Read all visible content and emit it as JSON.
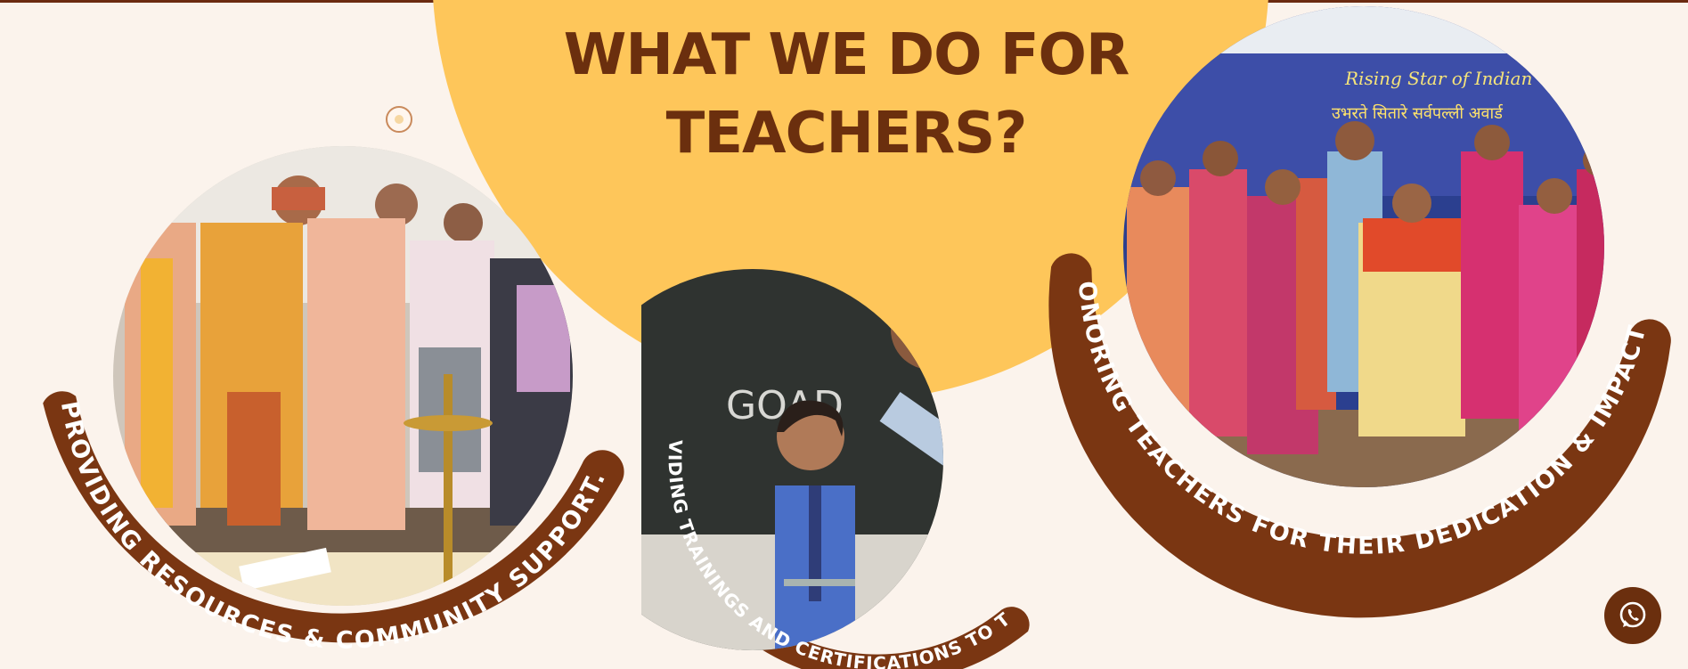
{
  "page": {
    "heading": "WHAT WE DO FOR TEACHERS?"
  },
  "cards": [
    {
      "caption": "PROVIDING RESOURCES & COMMUNITY SUPPORT.",
      "photo": "lamp-lighting-ceremony-photo"
    },
    {
      "caption": "PROVIDING TRAININGS AND CERTIFICATIONS TO THEM",
      "photo": "teacher-with-student-at-blackboard-photo"
    },
    {
      "caption": "HONORING TEACHERS FOR THEIR DEDICATION & IMPACT.",
      "photo": "award-ceremony-group-photo"
    }
  ],
  "photo_labels": {
    "blackboard_writing": "GOAD",
    "banner_title": "Rising Star of Indian",
    "banner_hindi": "उभरते सितारे सर्वपल्ली अवार्ड"
  },
  "colors": {
    "background": "#fbf3ec",
    "accent_yellow": "#fec65a",
    "brand_brown": "#6b2f0e",
    "caption_band": "#7a3612"
  },
  "chat_widget": {
    "icon": "whatsapp-icon"
  }
}
